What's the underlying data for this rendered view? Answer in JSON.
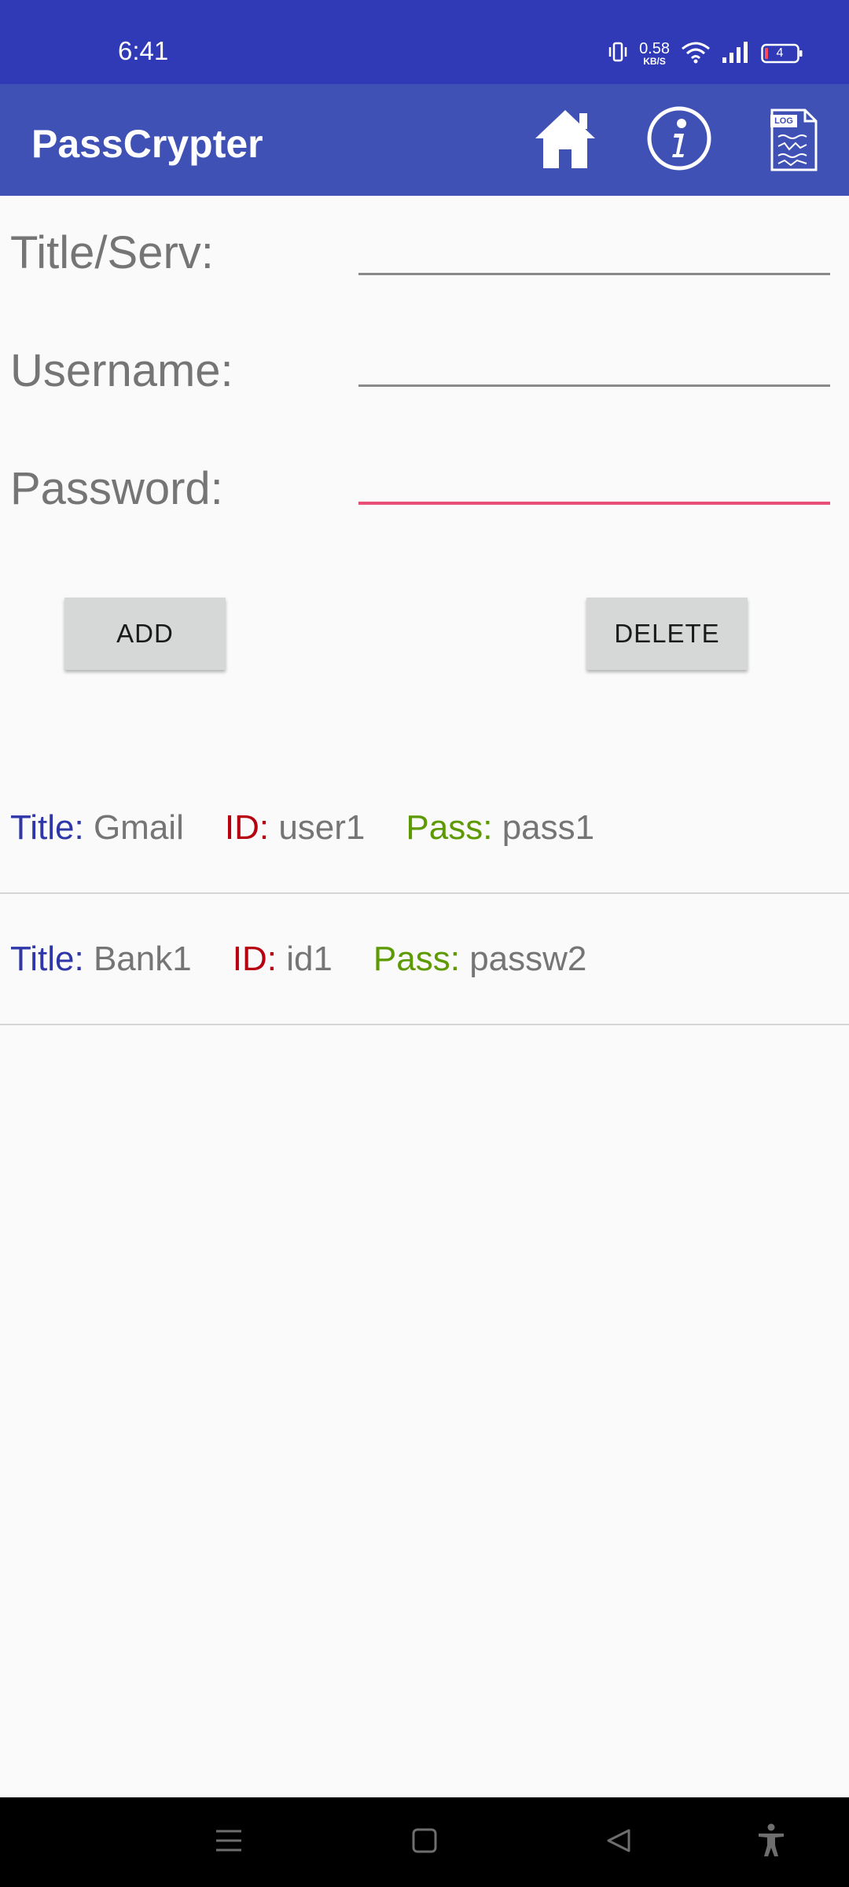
{
  "status_bar": {
    "time": "6:41",
    "net_speed_value": "0.58",
    "net_speed_unit": "KB/S",
    "battery_level": "4",
    "icons": [
      "vibrate-icon",
      "wifi-icon",
      "signal-icon",
      "battery-icon"
    ]
  },
  "app_bar": {
    "title": "PassCrypter",
    "actions": [
      "home-icon",
      "info-icon",
      "log-icon"
    ],
    "log_label": "LOG"
  },
  "form": {
    "title_label": "Title/Serv:",
    "title_value": "",
    "username_label": "Username:",
    "username_value": "",
    "password_label": "Password:",
    "password_value": "",
    "focused_field": "password"
  },
  "buttons": {
    "add_label": "ADD",
    "delete_label": "DELETE"
  },
  "entry_labels": {
    "title": "Title:",
    "id": "ID:",
    "pass": "Pass:"
  },
  "entries": [
    {
      "title": "Gmail",
      "id": "user1",
      "pass": "pass1"
    },
    {
      "title": "Bank1",
      "id": "id1",
      "pass": "passw2"
    }
  ],
  "nav_bar": {
    "buttons": [
      "menu-icon",
      "home-square-icon",
      "back-icon",
      "accessibility-icon"
    ]
  },
  "colors": {
    "status_bar": "#303ab7",
    "app_bar": "#3f51b5",
    "accent": "#e8507a",
    "title_key": "#2f37a8",
    "id_key": "#b7000f",
    "pass_key": "#5c9a00"
  }
}
